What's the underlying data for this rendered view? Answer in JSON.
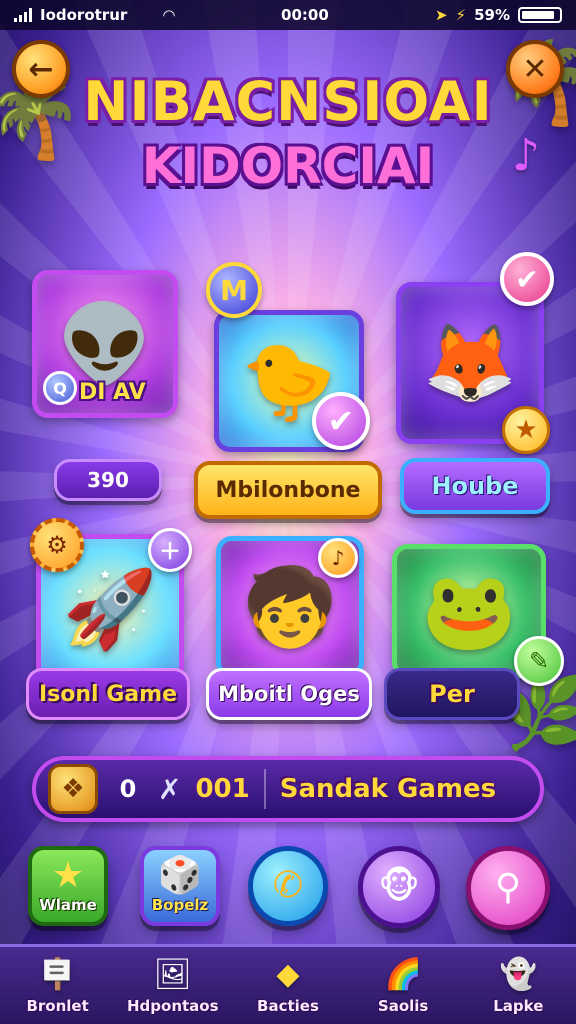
{
  "status_bar": {
    "carrier": "Iodorotrur",
    "time": "00:00",
    "battery": "59%"
  },
  "header": {
    "back_icon": "arrow-left-icon",
    "close_icon": "close-x-icon",
    "title_line1": "NIBACNSIOAI",
    "title_line2": "KIDORCIAI"
  },
  "cards": [
    {
      "creature": "green-goblin",
      "overlay": "DI AV"
    },
    {
      "creature": "yellow-bird"
    },
    {
      "creature": "orange-fox"
    },
    {
      "creature": "rocket-toy"
    },
    {
      "creature": "purple-hair-kid"
    },
    {
      "creature": "green-frog-drum"
    }
  ],
  "coins": {
    "m_coin": "M",
    "q_badge": "Q"
  },
  "labels": {
    "pill_1": "390",
    "pill_2": "Mbilonbone",
    "pill_3": "Hoube",
    "pill_4": "Isonl Game",
    "pill_5": "Mboitl Oges",
    "pill_6": "Per"
  },
  "stats": {
    "zero": "0",
    "count": "001",
    "label": "Sandak Games"
  },
  "actions": [
    {
      "icon": "star-icon",
      "label": "Wlame"
    },
    {
      "icon": "dice-box-icon",
      "label": "Bopelz"
    },
    {
      "icon": "phone-icon"
    },
    {
      "icon": "monkey-face-icon"
    },
    {
      "icon": "magnifier-icon"
    }
  ],
  "bottom_nav": [
    {
      "icon": "sign-post-icon",
      "label": "Bronlet"
    },
    {
      "icon": "picture-frame-icon",
      "label": "Hdpontaos"
    },
    {
      "icon": "diamond-icon",
      "label": "Bacties"
    },
    {
      "icon": "rainbow-card-icon",
      "label": "Saolis"
    },
    {
      "icon": "ghost-icon",
      "label": "Lapke"
    }
  ],
  "colors": {
    "accent_purple": "#c24cf0",
    "accent_yellow": "#ffd83a",
    "accent_orange": "#ff9a1f"
  }
}
